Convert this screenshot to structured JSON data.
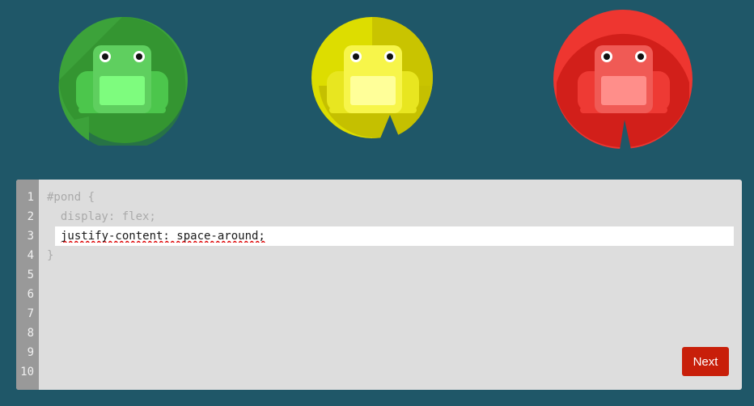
{
  "pond": {
    "frogs": [
      {
        "color": "green",
        "pad_color": "#2d8a2a",
        "pad_light": "#3da33a",
        "body": "#5fcf5f",
        "belly": "#7efc7e"
      },
      {
        "color": "yellow",
        "pad_color": "#c9c400",
        "pad_light": "#e0db00",
        "body": "#eeec33",
        "belly": "#ffff99"
      },
      {
        "color": "red",
        "pad_color": "#d21f1a",
        "pad_light": "#ee3630",
        "body": "#f05a55",
        "belly": "#ff8e8a"
      }
    ]
  },
  "editor": {
    "line_numbers": [
      "1",
      "2",
      "3",
      "4",
      "5",
      "6",
      "7",
      "8",
      "9",
      "10"
    ],
    "lines": [
      "#pond {",
      "  display: flex;",
      "",
      "}"
    ],
    "input_value": "justify-content: space-around;",
    "next_label": "Next"
  },
  "colors": {
    "background": "#1f5768",
    "editor_bg": "#dddddd",
    "gutter": "#999999",
    "next_button": "#c81f0a"
  }
}
